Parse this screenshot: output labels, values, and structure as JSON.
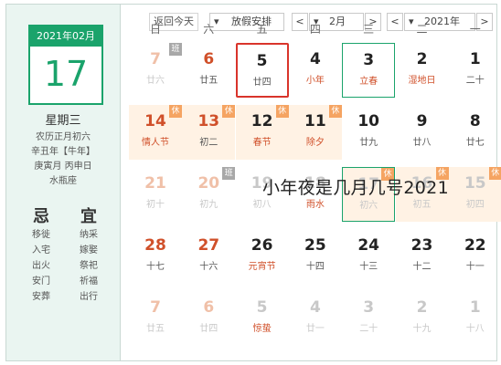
{
  "left": {
    "date_header": "2021年02月",
    "day": "17",
    "weekday": "星期三",
    "lunar": "农历正月初六",
    "ganzhi": "辛丑年【牛年】",
    "ganzhi2": "庚寅月 丙申日",
    "wuxing": "水瓶座",
    "yi_title": "宜",
    "ji_title": "忌",
    "yi_items": [
      "纳采",
      "嫁娶",
      "祭祀",
      "祈福",
      "出行"
    ],
    "ji_items": [
      "移徙",
      "入宅",
      "出火",
      "安门",
      "安葬"
    ]
  },
  "toolbar": {
    "back_today": "返回今天",
    "dropdown_arrow": "▾",
    "holiday_select": "放假安排",
    "prev": "<",
    "next": ">",
    "month": "2月",
    "year": "2021年",
    "prev_year": "<",
    "next_year": ">"
  },
  "weekdays": [
    "日",
    "六",
    "五",
    "四",
    "三",
    "二",
    "一"
  ],
  "badges": {
    "xiu": "休",
    "ban": "班"
  },
  "overlay_text": "小年夜是几月几号2021"
}
